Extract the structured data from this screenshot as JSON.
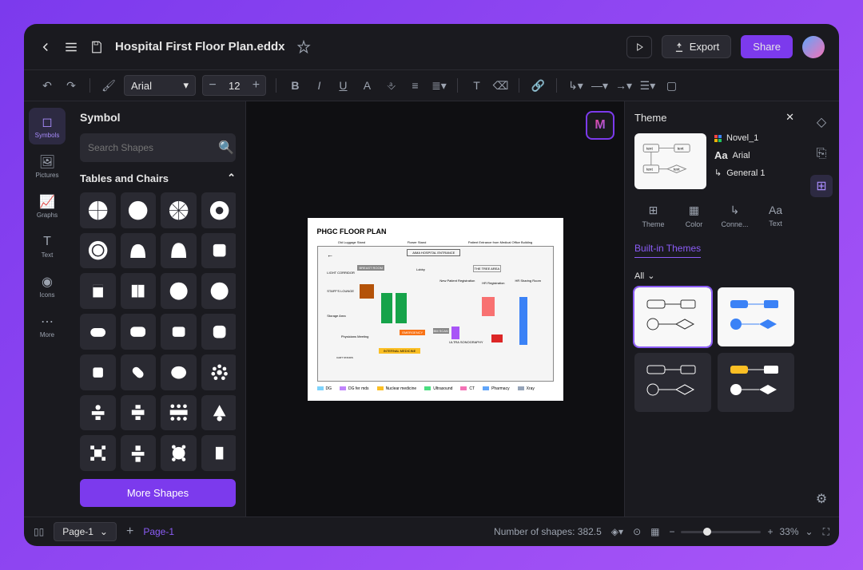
{
  "titlebar": {
    "filename": "Hospital First Floor Plan.eddx"
  },
  "toolbar": {
    "font": "Arial",
    "size": "12",
    "play": "Play",
    "export": "Export",
    "share": "Share"
  },
  "leftRail": {
    "items": [
      {
        "label": "Symbols"
      },
      {
        "label": "Pictures"
      },
      {
        "label": "Graphs"
      },
      {
        "label": "Text"
      },
      {
        "label": "Icons"
      },
      {
        "label": "More"
      }
    ]
  },
  "symbols": {
    "title": "Symbol",
    "searchPlaceholder": "Search Shapes",
    "category": "Tables and Chairs",
    "moreBtn": "More Shapes"
  },
  "floorPlan": {
    "title": "PHGC FLOOR PLAN",
    "legend": [
      {
        "label": "DG",
        "color": "#7dd3fc"
      },
      {
        "label": "DG fer mds",
        "color": "#c084fc"
      },
      {
        "label": "Nuclear medicine",
        "color": "#fbbf24"
      },
      {
        "label": "Ultrasound",
        "color": "#4ade80"
      },
      {
        "label": "CT",
        "color": "#f472b6"
      },
      {
        "label": "Pharmacy",
        "color": "#60a5fa"
      },
      {
        "label": "Xray",
        "color": "#94a3b8"
      }
    ]
  },
  "theme": {
    "title": "Theme",
    "name": "Novel_1",
    "font": "Arial",
    "connector": "General 1",
    "tabs": [
      "Theme",
      "Color",
      "Conne...",
      "Text"
    ],
    "builtIn": "Built-in Themes",
    "all": "All"
  },
  "statusbar": {
    "page": "Page-1",
    "pageLink": "Page-1",
    "shapes": "Number of shapes: 382.5",
    "zoom": "33%"
  }
}
